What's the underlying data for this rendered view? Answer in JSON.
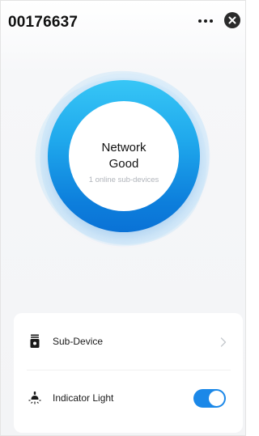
{
  "header": {
    "title": "00176637",
    "more_icon": "more-horizontal-icon",
    "close_icon": "close-icon"
  },
  "network": {
    "status_line1": "Network",
    "status_line2": "Good",
    "online_text": "1 online sub-devices"
  },
  "settings": {
    "items": [
      {
        "label": "Sub-Device",
        "icon": "sub-device-icon",
        "action": "chevron-right-icon"
      },
      {
        "label": "Indicator Light",
        "icon": "light-icon",
        "action": "toggle",
        "enabled": true
      }
    ]
  },
  "colors": {
    "accent": "#1b88e8",
    "ring_top": "#37c6f6",
    "ring_bottom": "#0a72d6"
  }
}
